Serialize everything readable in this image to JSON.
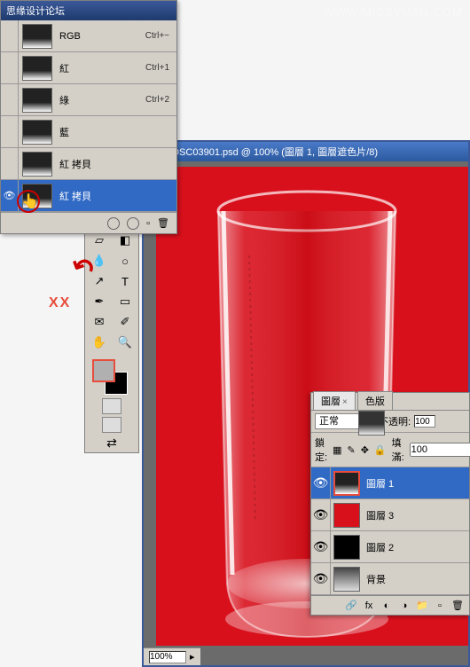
{
  "watermark": "WWW.MISSYUAN.COM",
  "channels": {
    "title": "思缘设计论坛",
    "items": [
      {
        "name": "RGB",
        "shortcut": "Ctrl+~"
      },
      {
        "name": "紅",
        "shortcut": "Ctrl+1"
      },
      {
        "name": "綠",
        "shortcut": "Ctrl+2"
      },
      {
        "name": "藍",
        "shortcut": ""
      },
      {
        "name": "紅 拷貝",
        "shortcut": ""
      },
      {
        "name": "紅 拷貝",
        "shortcut": ""
      }
    ]
  },
  "annotation": {
    "xx": "XX"
  },
  "ps_window": {
    "title": "_DSC03901.psd @ 100% (圖層 1, 圖層遮色片/8)",
    "zoom": "100%"
  },
  "layers": {
    "tabs": [
      "圖層",
      "色版"
    ],
    "blend": "正常",
    "opacity_label": "不透明:",
    "opacity": "100",
    "lock_label": "鎖定:",
    "fill_label": "填滿:",
    "fill": "100",
    "items": [
      {
        "name": "圖層 1"
      },
      {
        "name": "圖層 3"
      },
      {
        "name": "圖層 2"
      },
      {
        "name": "背景"
      }
    ]
  },
  "tools": {
    "names": [
      "move",
      "marquee",
      "lasso",
      "wand",
      "crop",
      "slice",
      "heal",
      "brush",
      "stamp",
      "history",
      "eraser",
      "gradient",
      "blur",
      "dodge",
      "path",
      "type",
      "pen",
      "shape",
      "notes",
      "eyedrop",
      "hand",
      "zoom"
    ]
  }
}
